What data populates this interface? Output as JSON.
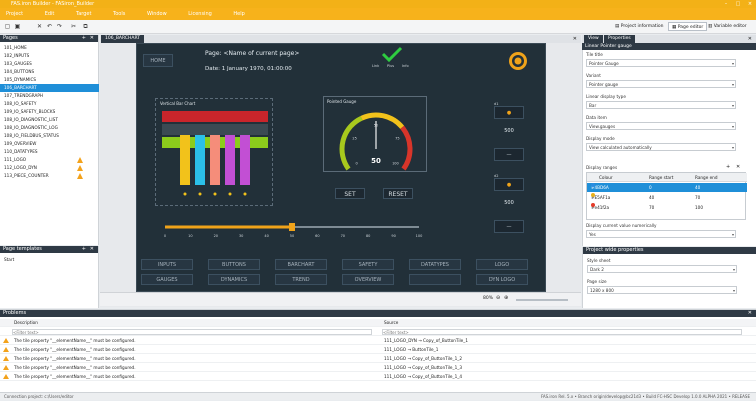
{
  "window": {
    "title": "FAS.iron Builder - FASiron_Builder"
  },
  "menu": [
    "Project",
    "Edit",
    "Target",
    "Tools",
    "Window",
    "Licensing",
    "Help"
  ],
  "toolbar": {
    "project_information": "Project information",
    "page_editor": "Page editor",
    "variable_editor": "Variable editor"
  },
  "pages_panel": {
    "title": "Pages",
    "items": [
      {
        "label": "101_HOME",
        "selected": false,
        "warning": false
      },
      {
        "label": "102_INPUTS",
        "selected": false,
        "warning": false
      },
      {
        "label": "103_GAUGES",
        "selected": false,
        "warning": false
      },
      {
        "label": "104_BUTTONS",
        "selected": false,
        "warning": false
      },
      {
        "label": "105_DYNAMICS",
        "selected": false,
        "warning": false
      },
      {
        "label": "106_BARCHART",
        "selected": true,
        "warning": false
      },
      {
        "label": "107_TRENDGRAPH",
        "selected": false,
        "warning": false
      },
      {
        "label": "108_IO_SAFETY",
        "selected": false,
        "warning": false
      },
      {
        "label": "109_IO_SAFETY_BLOCKS",
        "selected": false,
        "warning": false
      },
      {
        "label": "108_IO_DIAGNOSTIC_LIST",
        "selected": false,
        "warning": false
      },
      {
        "label": "108_IO_DIAGNOSTIC_LOG",
        "selected": false,
        "warning": false
      },
      {
        "label": "108_IO_FIELDBUS_STATUS",
        "selected": false,
        "warning": false
      },
      {
        "label": "109_OVERVIEW",
        "selected": false,
        "warning": false
      },
      {
        "label": "110_DATATYPES",
        "selected": false,
        "warning": false
      },
      {
        "label": "111_LOGO",
        "selected": false,
        "warning": true
      },
      {
        "label": "112_LOGO_DYN",
        "selected": false,
        "warning": true
      },
      {
        "label": "113_PIECE_COUNTER",
        "selected": false,
        "warning": true
      }
    ]
  },
  "templates_panel": {
    "title": "Page templates",
    "items": [
      "Start"
    ]
  },
  "editor": {
    "tab": "106_BARCHART",
    "home_label": "HOME",
    "page_title": "Page: <Name of current page>",
    "date_text": "Date: 1 January 1970, 01:00:00",
    "status_labels": [
      "Link",
      "Plus",
      "Info"
    ],
    "barchart_title": "Vertical Bar Chart",
    "barchart_values": [
      100,
      85,
      40
    ],
    "bar_colors": [
      "#f2c21b",
      "#2bc0e8",
      "#f58d7a",
      "#c24fd4",
      "#c24fd4"
    ],
    "gauge_title": "Pointed Gauge",
    "gauge_value": "50",
    "gauge_ticks": [
      "0",
      "25",
      "50",
      "75",
      "100"
    ],
    "set_label": "SET",
    "reset_label": "RESET",
    "slider_ticks": [
      "0",
      "10",
      "20",
      "30",
      "40",
      "50",
      "60",
      "70",
      "80",
      "90",
      "100"
    ],
    "slider_value": 50,
    "right_top": {
      "label": "d1",
      "value": "500"
    },
    "right_bottom": {
      "label": "d2",
      "value": "500"
    },
    "nav_row1": [
      "INPUTS",
      "BUTTONS",
      "BARCHART",
      "SAFETY",
      "DATATYPES",
      "LOGO"
    ],
    "nav_row2": [
      "GAUGES",
      "DYNAMICS",
      "TREND",
      "OVERVIEW",
      "",
      "DYN LOGO"
    ],
    "zoom": "80%"
  },
  "properties": {
    "tabs": [
      "View",
      "Properties"
    ],
    "header": "Linear Pointer gauge",
    "fields": [
      {
        "label": "Tile title",
        "value": "Pointer Gauge"
      },
      {
        "label": "Variant",
        "value": "Pointer gauge"
      },
      {
        "label": "Linear display type",
        "value": "Bar"
      },
      {
        "label": "Data item",
        "value": "View.gauges"
      },
      {
        "label": "Display mode",
        "value": "View calculated automatically"
      }
    ],
    "ranges": {
      "title": "Display ranges",
      "columns": [
        "Colour",
        "Range start",
        "Range end"
      ],
      "rows": [
        {
          "name": "#4BD6A",
          "color": "#2b8de0",
          "start": "0",
          "end": "40",
          "selected": true
        },
        {
          "name": "#E5AF1a",
          "color": "#e9b21c",
          "start": "40",
          "end": "70",
          "selected": false
        },
        {
          "name": "#e41f2a",
          "color": "#e43c2a",
          "start": "70",
          "end": "100",
          "selected": false
        }
      ]
    },
    "display_numerical": {
      "label": "Display current value numerically",
      "value": "Yes"
    }
  },
  "project_styles": {
    "title": "Project wide properties",
    "style_sheet": {
      "label": "Style sheet",
      "value": "Dark 2"
    },
    "page_size": {
      "label": "Page size",
      "value": "1280 x 800"
    }
  },
  "problems": {
    "title": "Problems",
    "columns": [
      "Description",
      "Source"
    ],
    "filter_placeholder": "<Filter text>",
    "rows": [
      {
        "description": "The tile property \"__elementName__\" must be configured.",
        "source": "111_LOGO_DYN → Copy_of_ButtonTile_1"
      },
      {
        "description": "The tile property \"__elementName__\" must be configured.",
        "source": "111_LOGO → ButtonTile_1"
      },
      {
        "description": "The tile property \"__elementName__\" must be configured.",
        "source": "111_LOGO → Copy_of_ButtonTile_1_2"
      },
      {
        "description": "The tile property \"__elementName__\" must be configured.",
        "source": "111_LOGO → Copy_of_ButtonTile_1_3"
      },
      {
        "description": "The tile property \"__elementName__\" must be configured.",
        "source": "111_LOGO → Copy_of_ButtonTile_1_4"
      }
    ]
  },
  "status_bar": {
    "left": "Connection project: c:/Users/editor",
    "right": "FAS.iron Rel. 5.x • Branch origin/develop@bc21d3 • Build FC-HSC Develop 1.0.0 ALPHA 2021 • RELEASE"
  }
}
